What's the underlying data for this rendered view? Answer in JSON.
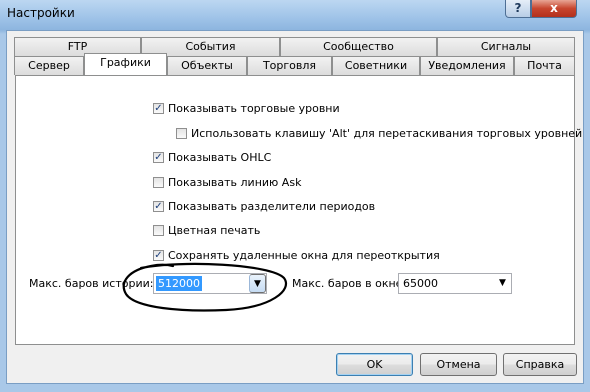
{
  "window": {
    "title": "Настройки"
  },
  "title_buttons": {
    "help": "?",
    "close": "x"
  },
  "tabs_row_back": [
    "FTP",
    "События",
    "Сообщество",
    "Сигналы"
  ],
  "tabs_row_front": [
    "Сервер",
    "Графики",
    "Объекты",
    "Торговля",
    "Советники",
    "Уведомления",
    "Почта"
  ],
  "active_tab": "Графики",
  "options": [
    {
      "label": "Показывать торговые уровни",
      "checked": true
    },
    {
      "label": "Использовать клавишу 'Alt' для перетаскивания торговых уровней",
      "checked": false
    },
    {
      "label": "Показывать OHLC",
      "checked": true
    },
    {
      "label": "Показывать линию Ask",
      "checked": false
    },
    {
      "label": "Показывать разделители периодов",
      "checked": true
    },
    {
      "label": "Цветная печать",
      "checked": false
    },
    {
      "label": "Сохранять удаленные окна для переоткрытия",
      "checked": true
    }
  ],
  "max_bars_history": {
    "label": "Макс. баров истории:",
    "value": "512000"
  },
  "max_bars_window": {
    "label": "Макс. баров в окне:",
    "value": "65000"
  },
  "buttons": {
    "ok": "OK",
    "cancel": "Отмена",
    "help": "Справка"
  },
  "check_mark": "✓",
  "dropdown_arrow": "▼"
}
